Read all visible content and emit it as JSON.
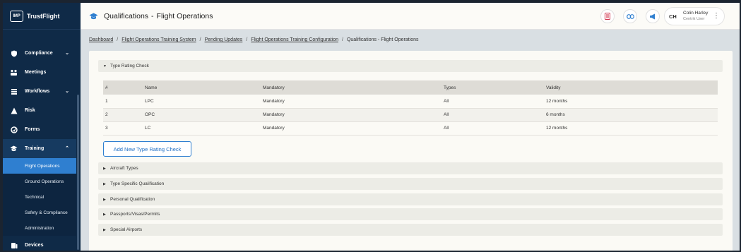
{
  "brand": {
    "logo": "IMP",
    "name": "TrustFlight"
  },
  "sidebar": {
    "items": [
      {
        "label": "Compliance",
        "icon": "shield-icon",
        "expandable": true
      },
      {
        "label": "Meetings",
        "icon": "meetings-icon",
        "expandable": false
      },
      {
        "label": "Workflows",
        "icon": "workflow-icon",
        "expandable": true
      },
      {
        "label": "Risk",
        "icon": "risk-icon",
        "expandable": false
      },
      {
        "label": "Forms",
        "icon": "forms-icon",
        "expandable": false
      },
      {
        "label": "Training",
        "icon": "graduation-cap-icon",
        "expandable": true,
        "open": true
      },
      {
        "label": "Devices",
        "icon": "devices-icon",
        "expandable": false
      }
    ],
    "training_sub": [
      {
        "label": "Flight Operations",
        "active": true
      },
      {
        "label": "Ground Operations"
      },
      {
        "label": "Technical"
      },
      {
        "label": "Safety & Compliance"
      },
      {
        "label": "Administration"
      }
    ]
  },
  "header": {
    "title": "Qualifications",
    "subtitle": "Flight Operations",
    "separator": "-",
    "user": {
      "initials": "CH",
      "name": "Colin Harley",
      "role": "Centrik User"
    }
  },
  "breadcrumb": {
    "items": [
      "Dashboard",
      "Flight Operations Training System",
      "Pending Updates",
      "Flight Operations Training Configuration"
    ],
    "current": "Qualifications - Flight Operations",
    "separator": "/"
  },
  "sections": {
    "type_rating": {
      "label": "Type Rating Check",
      "expanded": true
    },
    "collapsed": [
      "Aircraft Types",
      "Type Specific Qualification",
      "Personal Qualification",
      "Passports/Visas/Permits",
      "Special Airports"
    ]
  },
  "table": {
    "headers": [
      "#",
      "Name",
      "Mandatory",
      "Types",
      "Validity"
    ],
    "rows": [
      [
        "1",
        "LPC",
        "Mandatory",
        "All",
        "12 months"
      ],
      [
        "2",
        "OPC",
        "Mandatory",
        "All",
        "6 months"
      ],
      [
        "3",
        "LC",
        "Mandatory",
        "All",
        "12 months"
      ]
    ]
  },
  "add_button": "Add New Type Rating Check",
  "colors": {
    "sidebar_bg": "#0f2a47",
    "active_item": "#2f7fd0",
    "accent": "#1f6fc5",
    "content_bg": "#d9dfe3",
    "card_bg": "#fbfaf5"
  }
}
